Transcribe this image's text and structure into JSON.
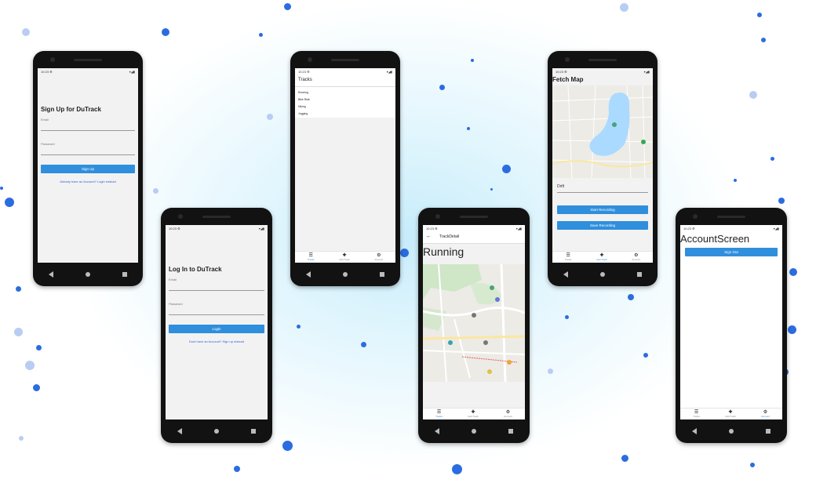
{
  "phone1": {
    "title": "Sign Up for DuTrack",
    "email_label": "Email",
    "password_label": "Password",
    "button": "Sign Up",
    "link": "Already have an Account? Login instead"
  },
  "phone2": {
    "title": "Log In to DuTrack",
    "email_label": "Email",
    "password_label": "Password",
    "button": "Login",
    "link": "Dont have an Account? Sign up instead"
  },
  "phone3": {
    "header": "Tracks",
    "items": [
      "Running",
      "Bike Ride",
      "Hiking",
      "Jogging"
    ]
  },
  "phone4": {
    "header": "TrackDetail",
    "name": "Running"
  },
  "phone5": {
    "title": "Fetch Map",
    "input_value": "Drift",
    "start_button": "Start Recording",
    "save_button": "Save Recording"
  },
  "phone6": {
    "title": "AccountScreen",
    "button": "Sign Out"
  },
  "tabs": {
    "tracks": "Tracks",
    "add": "Add Track",
    "account": "Account"
  },
  "colors": {
    "accent": "#2f8fdd",
    "link": "#3b5fe0",
    "background_glow": "#c8ecfb",
    "dots": "#2b6de0"
  },
  "icons": {
    "tracks": "list-icon",
    "add": "plus-icon",
    "account": "gear-icon",
    "back": "arrow-left-icon"
  }
}
